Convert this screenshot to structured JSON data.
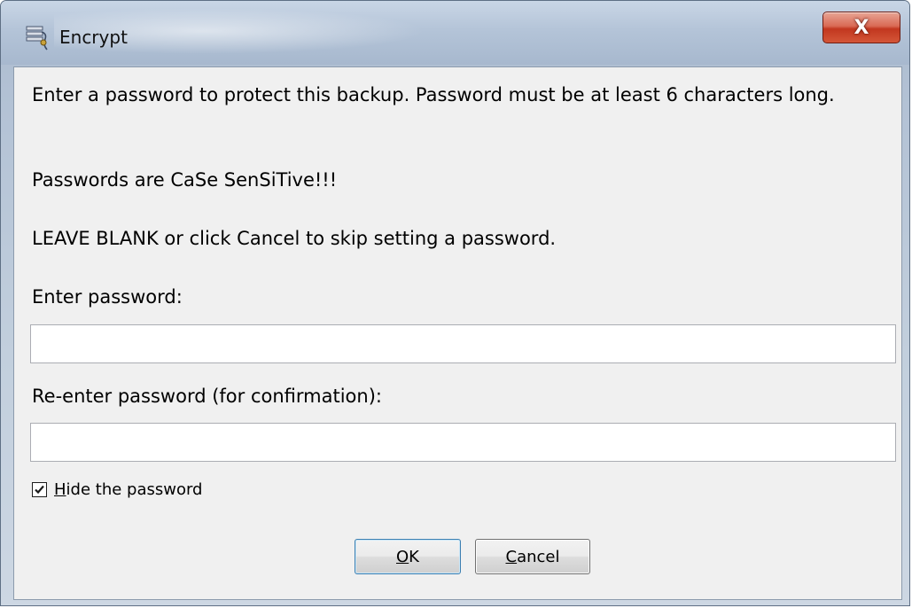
{
  "window": {
    "title": "Encrypt",
    "close_symbol": "X"
  },
  "messages": {
    "intro": "Enter a password to protect this backup.  Password must be at least 6 characters long.",
    "case_warning": "Passwords are CaSe SenSiTive!!!",
    "skip_hint": "LEAVE BLANK or click Cancel to skip setting a password.",
    "enter_label": "Enter password:",
    "reenter_label": "Re-enter password (for confirmation):"
  },
  "fields": {
    "password": {
      "value": "",
      "placeholder": ""
    },
    "confirm": {
      "value": "",
      "placeholder": ""
    }
  },
  "checkbox": {
    "label_mnemonic": "H",
    "label_rest": "ide the password",
    "checked": true
  },
  "buttons": {
    "ok_mnemonic": "O",
    "ok_rest": "K",
    "cancel_mnemonic": "C",
    "cancel_rest": "ancel"
  },
  "icons": {
    "app": "encrypt-app-icon",
    "close": "close-icon",
    "check": "checkmark-icon"
  },
  "colors": {
    "client_bg": "#f0f0f0",
    "close_red": "#c2371f",
    "titlebar": "#b4c4d8"
  }
}
